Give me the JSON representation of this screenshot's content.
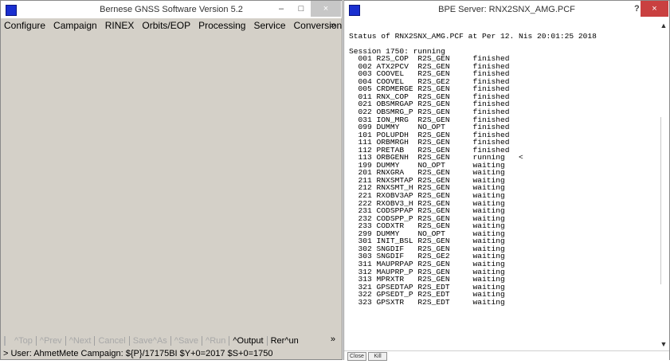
{
  "left_window": {
    "title": "Bernese GNSS Software Version 5.2",
    "minimize": "–",
    "maximize": "□",
    "close": "×",
    "menu": [
      "Configure",
      "Campaign",
      "RINEX",
      "Orbits/EOP",
      "Processing",
      "Service",
      "Conversion"
    ],
    "menu_more": "»",
    "toolbar": {
      "top": "^Top",
      "prev": "^Prev",
      "next": "^Next",
      "cancel": "Cancel",
      "save_as": "Save^As",
      "save": "^Save",
      "run": "^Run",
      "output": "^Output",
      "rerun": "Rer^un",
      "more": "»"
    },
    "status": "> User: AhmetMete  Campaign: ${P}/17175BI  $Y+0=2017  $S+0=1750"
  },
  "right_window": {
    "title": "BPE Server: RNX2SNX_AMG.PCF",
    "help": "?",
    "close": "×",
    "output_lines": [
      "",
      "Status of RNX2SNX_AMG.PCF at Per 12. Nis 20:01:25 2018",
      "",
      "Session 1750: running",
      "  001 R2S_COP  R2S_GEN     finished",
      "  002 ATX2PCV  R2S_GEN     finished",
      "  003 COOVEL   R2S_GEN     finished",
      "  004 COOVEL   R2S_GE2     finished",
      "  005 CRDMERGE R2S_GEN     finished",
      "  011 RNX_COP  R2S_GEN     finished",
      "  021 OBSMRGAP R2S_GEN     finished",
      "  022 OBSMRG_P R2S_GEN     finished",
      "  031 ION_MRG  R2S_GEN     finished",
      "  099 DUMMY    NO_OPT      finished",
      "  101 POLUPDH  R2S_GEN     finished",
      "  111 ORBMRGH  R2S_GEN     finished",
      "  112 PRETAB   R2S_GEN     finished",
      "  113 ORBGENH  R2S_GEN     running   <",
      "  199 DUMMY    NO_OPT      waiting",
      "  201 RNXGRA   R2S_GEN     waiting",
      "  211 RNXSMTAP R2S_GEN     waiting",
      "  212 RNXSMT_H R2S_GEN     waiting",
      "  221 RXOBV3AP R2S_GEN     waiting",
      "  222 RXOBV3_H R2S_GEN     waiting",
      "  231 CODSPPAP R2S_GEN     waiting",
      "  232 CODSPP_P R2S_GEN     waiting",
      "  233 CODXTR   R2S_GEN     waiting",
      "  299 DUMMY    NO_OPT      waiting",
      "  301 INIT_BSL R2S_GEN     waiting",
      "  302 SNGDIF   R2S_GEN     waiting",
      "  303 SNGDIF   R2S_GE2     waiting",
      "  311 MAUPRPAP R2S_GEN     waiting",
      "  312 MAUPRP_P R2S_GEN     waiting",
      "  313 MPRXTR   R2S_GEN     waiting",
      "  321 GPSEDTAP R2S_EDT     waiting",
      "  322 GPSEDT_P R2S_EDT     waiting",
      "  323 GPSXTR   R2S_EDT     waiting"
    ],
    "close_button": "Close",
    "kill_button": "Kill",
    "scroll_up": "▲",
    "scroll_down": "▼"
  }
}
